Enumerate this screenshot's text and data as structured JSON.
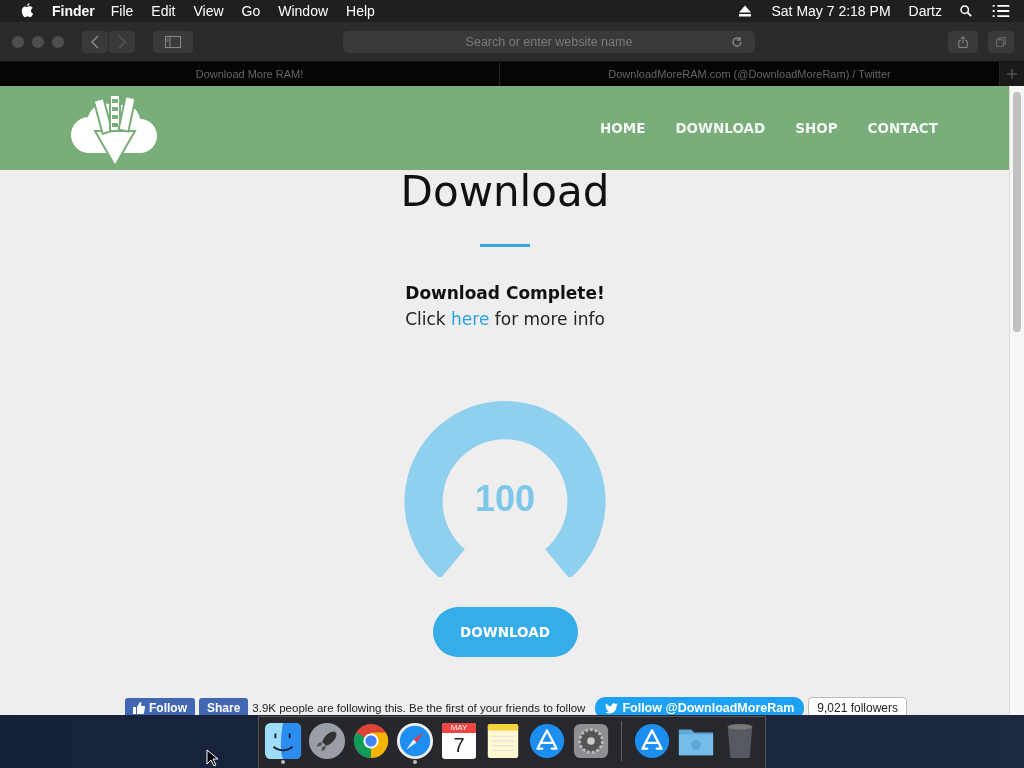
{
  "menubar": {
    "app": "Finder",
    "menus": [
      "File",
      "Edit",
      "View",
      "Go",
      "Window",
      "Help"
    ],
    "clock": "Sat May 7  2:18 PM",
    "user": "Dartz"
  },
  "browser": {
    "address_placeholder": "Search or enter website name",
    "tabs": [
      {
        "title": "Download More RAM!"
      },
      {
        "title": "DownloadMoreRAM.com (@DownloadMoreRam) / Twitter"
      }
    ]
  },
  "site": {
    "nav": [
      "HOME",
      "DOWNLOAD",
      "SHOP",
      "CONTACT"
    ],
    "title": "Download",
    "status": "Download Complete!",
    "info_before": "Click ",
    "info_link": "here",
    "info_after": " for more info",
    "gauge": {
      "value": "100",
      "level": 1
    },
    "button": "DOWNLOAD",
    "social": {
      "fb_follow": "Follow",
      "fb_share": "Share",
      "fb_text": "3.9K people are following this. Be the first of your friends to follow",
      "tw_follow": "Follow @DownloadMoreRam",
      "followers": "9,021 followers"
    }
  },
  "dock": [
    {
      "kind": "finder",
      "running": true
    },
    {
      "kind": "rocket",
      "running": false
    },
    {
      "kind": "chrome",
      "running": false
    },
    {
      "kind": "safari",
      "running": true
    },
    {
      "kind": "calendar",
      "running": false,
      "month": "MAY",
      "day": "7"
    },
    {
      "kind": "notes",
      "running": false
    },
    {
      "kind": "appstore",
      "running": false
    },
    {
      "kind": "settings",
      "running": false
    },
    {
      "kind": "divider"
    },
    {
      "kind": "appstore",
      "running": false
    },
    {
      "kind": "folder",
      "running": false
    },
    {
      "kind": "trash",
      "running": false
    }
  ]
}
